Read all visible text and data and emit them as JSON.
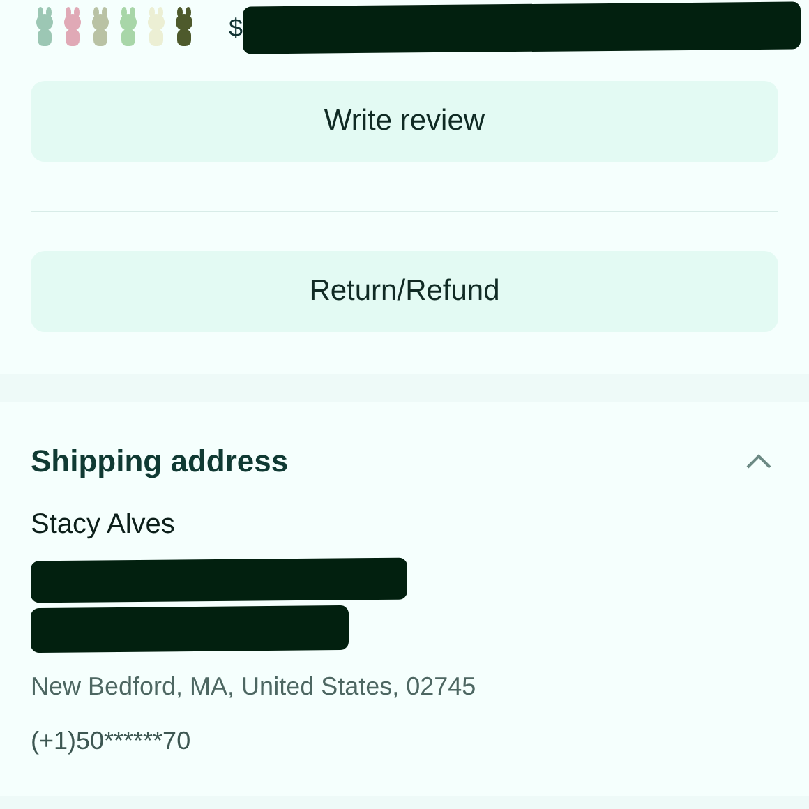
{
  "product": {
    "kind": "picture",
    "price": "$"
  },
  "actions": [
    {
      "label": "Write review"
    },
    {
      "label": "Return/Refund"
    }
  ],
  "shipping": {
    "title": "Shipping address",
    "expanded": true,
    "name": "Stacy Alves",
    "city_line": "New Bedford, MA, United States, 02745",
    "phone": "(+1)50******70"
  }
}
